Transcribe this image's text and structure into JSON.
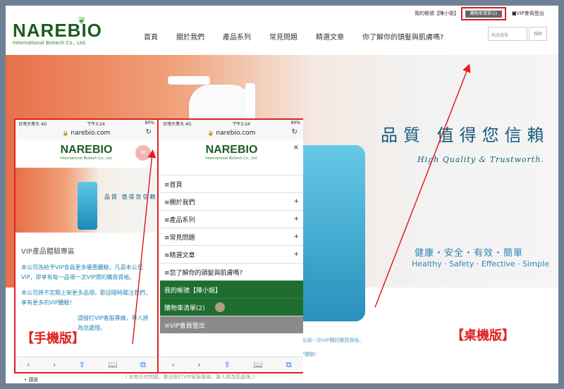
{
  "header": {
    "logo_word": "NAREBI",
    "logo_tail": "O",
    "logo_sub": "International Biotech Co., Ltd.",
    "account": "我的帳號【陳小姐】",
    "cart": "購物車清單(2)",
    "vip_logout": "■VIP會員登出",
    "nav": [
      "首頁",
      "關於我們",
      "產品系列",
      "常見問題",
      "精選文章",
      "你了解你的頭髮與肌膚嗎?"
    ],
    "search_placeholder": "商品搜尋",
    "go_label": "GO"
  },
  "hero": {
    "slogan_cn": "品質 值得您信賴",
    "slogan_en": "High Quality & Trustworth.",
    "tags_cn": "健康・安全・有效・簡單",
    "tags_en": "Healthy · Safety · Effective · Simple"
  },
  "desktop_body": {
    "line1": "品項一次VIP價的購買資格。",
    "line2": "P體驗！",
    "label": "【桌機版】",
    "bottom_note": "( 如有任何問題，歡迎撥打VIP客服專線，專人將為您處理。)",
    "bottom_bullet": "• 頭皮"
  },
  "phone": {
    "carrier": "台灣大哥大 4G",
    "time": "下午3:24",
    "battery": "80%",
    "url": "narebio.com",
    "logo_word": "NAREBIO",
    "logo_sub": "International Biotech Co., Ltd.",
    "hero_slogan": "品質 值得您信賴",
    "title": "VIP產品體驗專區",
    "body1": "本公司為給予VIP會員更多優惠體驗，凡是本公司VIP，即享有每一品項一次VIP價的購買資格。",
    "body2": "本公司將不定期上架更多品項，歡迎隨時關注我們，享有更多的VIP體驗！",
    "body3": "請撥打VIP客服專線，專人將為您處理。",
    "label": "【手機版】",
    "menu": [
      {
        "label": "≡首頁",
        "plus": ""
      },
      {
        "label": "≡關於我們",
        "plus": "+"
      },
      {
        "label": "≡產品系列",
        "plus": "+"
      },
      {
        "label": "≡常見問題",
        "plus": "+"
      },
      {
        "label": "≡精選文章",
        "plus": "+"
      },
      {
        "label": "≡您了解你的頭髮與肌膚嗎?",
        "plus": ""
      }
    ],
    "menu_account": "我的帳號【陳小姐】",
    "menu_cart": "購物車清單(2)",
    "menu_logout": "≡VIP會員登出",
    "close": "×"
  },
  "colors": {
    "annotation_red": "#e02020",
    "brand_green": "#1b5e20",
    "accent_blue": "#2a86b4"
  }
}
